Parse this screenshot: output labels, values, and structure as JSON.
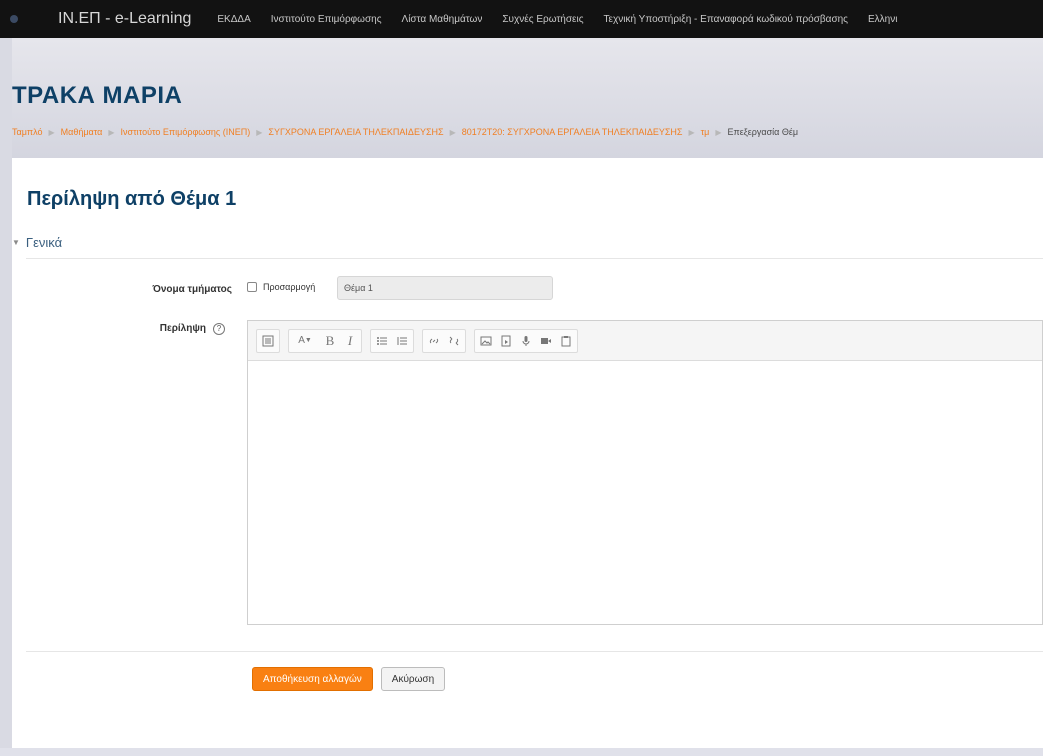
{
  "navbar": {
    "brand": "ΙΝ.ΕΠ - e-Learning",
    "items": [
      "ΕΚΔΔΑ",
      "Ινστιτούτο Επιμόρφωσης",
      "Λίστα Μαθημάτων",
      "Συχνές Ερωτήσεις",
      "Τεχνική Υποστήριξη - Επαναφορά κωδικού πρόσβασης",
      "Ελληνι"
    ]
  },
  "header": {
    "title": "ΤΡΑΚΑ ΜΑΡΙΑ",
    "breadcrumb": [
      "Ταμπλό",
      "Μαθήματα",
      "Ινστιτούτο Επιμόρφωσης (ΙΝΕΠ)",
      "ΣΥΓΧΡΟΝΑ ΕΡΓΑΛΕΙΑ ΤΗΛΕΚΠΑΙΔΕΥΣΗΣ",
      "80172Τ20: ΣΥΓΧΡΟΝΑ ΕΡΓΑΛΕΙΑ ΤΗΛΕΚΠΑΙΔΕΥΣΗΣ",
      "τμ",
      "Επεξεργασία Θέμ"
    ]
  },
  "form": {
    "title": "Περίληψη από Θέμα 1",
    "section_label": "Γενικά",
    "section_name_label": "Όνομα τμήματος",
    "customize_label": "Προσαρμογή",
    "section_name_value": "Θέμα 1",
    "summary_label": "Περίληψη",
    "help_icon_glyph": "?",
    "save_label": "Αποθήκευση αλλαγών",
    "cancel_label": "Ακύρωση"
  },
  "colors": {
    "navbar_bg": "#121212",
    "title_color": "#0e4066",
    "breadcrumb_link": "#f07f23",
    "primary_button": "#f98012"
  },
  "toolbar_icons": [
    "toolbar-toggle-icon",
    "paragraph-style-icon",
    "bold-icon",
    "italic-icon",
    "unordered-list-icon",
    "ordered-list-icon",
    "link-icon",
    "unlink-icon",
    "image-icon",
    "media-icon",
    "record-audio-icon",
    "record-video-icon",
    "manage-files-icon"
  ]
}
